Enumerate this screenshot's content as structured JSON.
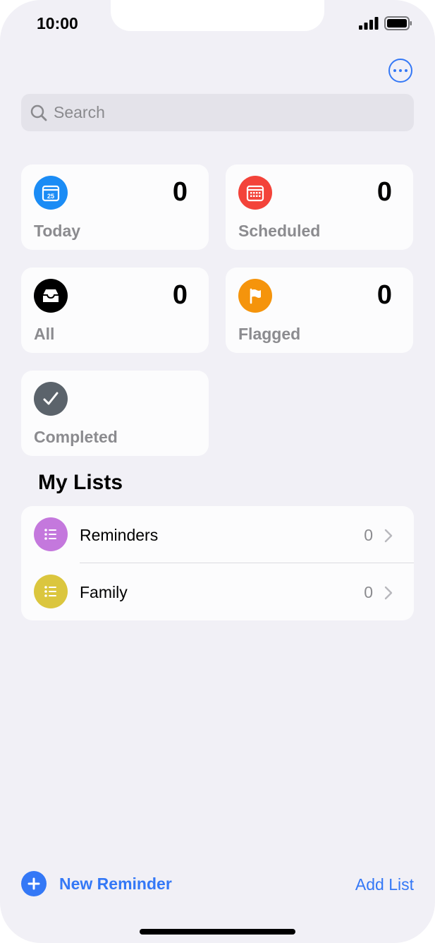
{
  "status_bar": {
    "time": "10:00"
  },
  "search": {
    "placeholder": "Search"
  },
  "smart_lists": [
    {
      "label": "Today",
      "count": "0",
      "icon": "calendar-today-icon",
      "color": "#1b8cf5",
      "icon_text": "25"
    },
    {
      "label": "Scheduled",
      "count": "0",
      "icon": "calendar-icon",
      "color": "#f3433a"
    },
    {
      "label": "All",
      "count": "0",
      "icon": "tray-icon",
      "color": "#000000"
    },
    {
      "label": "Flagged",
      "count": "0",
      "icon": "flag-icon",
      "color": "#f5940c"
    },
    {
      "label": "Completed",
      "icon": "checkmark-icon",
      "color": "#5b636b"
    }
  ],
  "my_lists": {
    "title": "My Lists",
    "items": [
      {
        "label": "Reminders",
        "count": "0",
        "color": "#c478dd"
      },
      {
        "label": "Family",
        "count": "0",
        "color": "#dbc63e"
      }
    ]
  },
  "toolbar": {
    "new_reminder_label": "New Reminder",
    "add_list_label": "Add List"
  },
  "colors": {
    "accent": "#3478f6",
    "background": "#f1f0f6"
  }
}
